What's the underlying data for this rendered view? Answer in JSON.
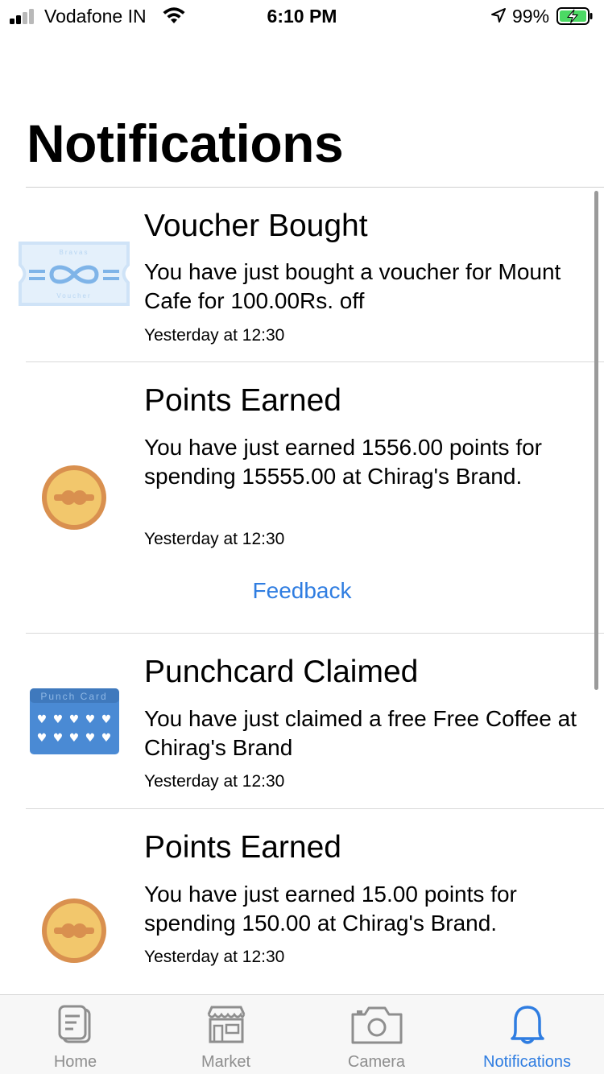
{
  "status_bar": {
    "carrier": "Vodafone IN",
    "time": "6:10 PM",
    "battery_percent": "99%"
  },
  "page": {
    "title": "Notifications"
  },
  "notifications": [
    {
      "icon": "voucher-icon",
      "title": "Voucher Bought",
      "body": "You have just bought a voucher for Mount Cafe for 100.00Rs. off",
      "time": "Yesterday at 12:30",
      "icon_text_top": "Bravas",
      "icon_text_bottom": "Voucher"
    },
    {
      "icon": "points-coin-icon",
      "title": "Points Earned",
      "body": "You have just earned 1556.00 points for spending 15555.00 at Chirag's Brand.",
      "time": "Yesterday at 12:30",
      "action": "Feedback"
    },
    {
      "icon": "punch-card-icon",
      "title": "Punchcard Claimed",
      "body": "You have just claimed a free Free Coffee at Chirag's Brand",
      "time": "Yesterday at 12:30",
      "icon_text": "Punch Card"
    },
    {
      "icon": "points-coin-icon",
      "title": "Points Earned",
      "body": "You have just earned 15.00 points for spending 150.00 at Chirag's Brand.",
      "time": "Yesterday at 12:30"
    }
  ],
  "tab_bar": {
    "tabs": [
      {
        "label": "Home",
        "icon": "home-document-icon",
        "active": false
      },
      {
        "label": "Market",
        "icon": "market-store-icon",
        "active": false
      },
      {
        "label": "Camera",
        "icon": "camera-icon",
        "active": false
      },
      {
        "label": "Notifications",
        "icon": "bell-icon",
        "active": true
      }
    ]
  },
  "colors": {
    "accent": "#2f7de1",
    "voucher": "#cfe3f7",
    "punch_card": "#4a8ad4",
    "coin_outer": "#d9904f",
    "coin_inner": "#f2c76c"
  }
}
